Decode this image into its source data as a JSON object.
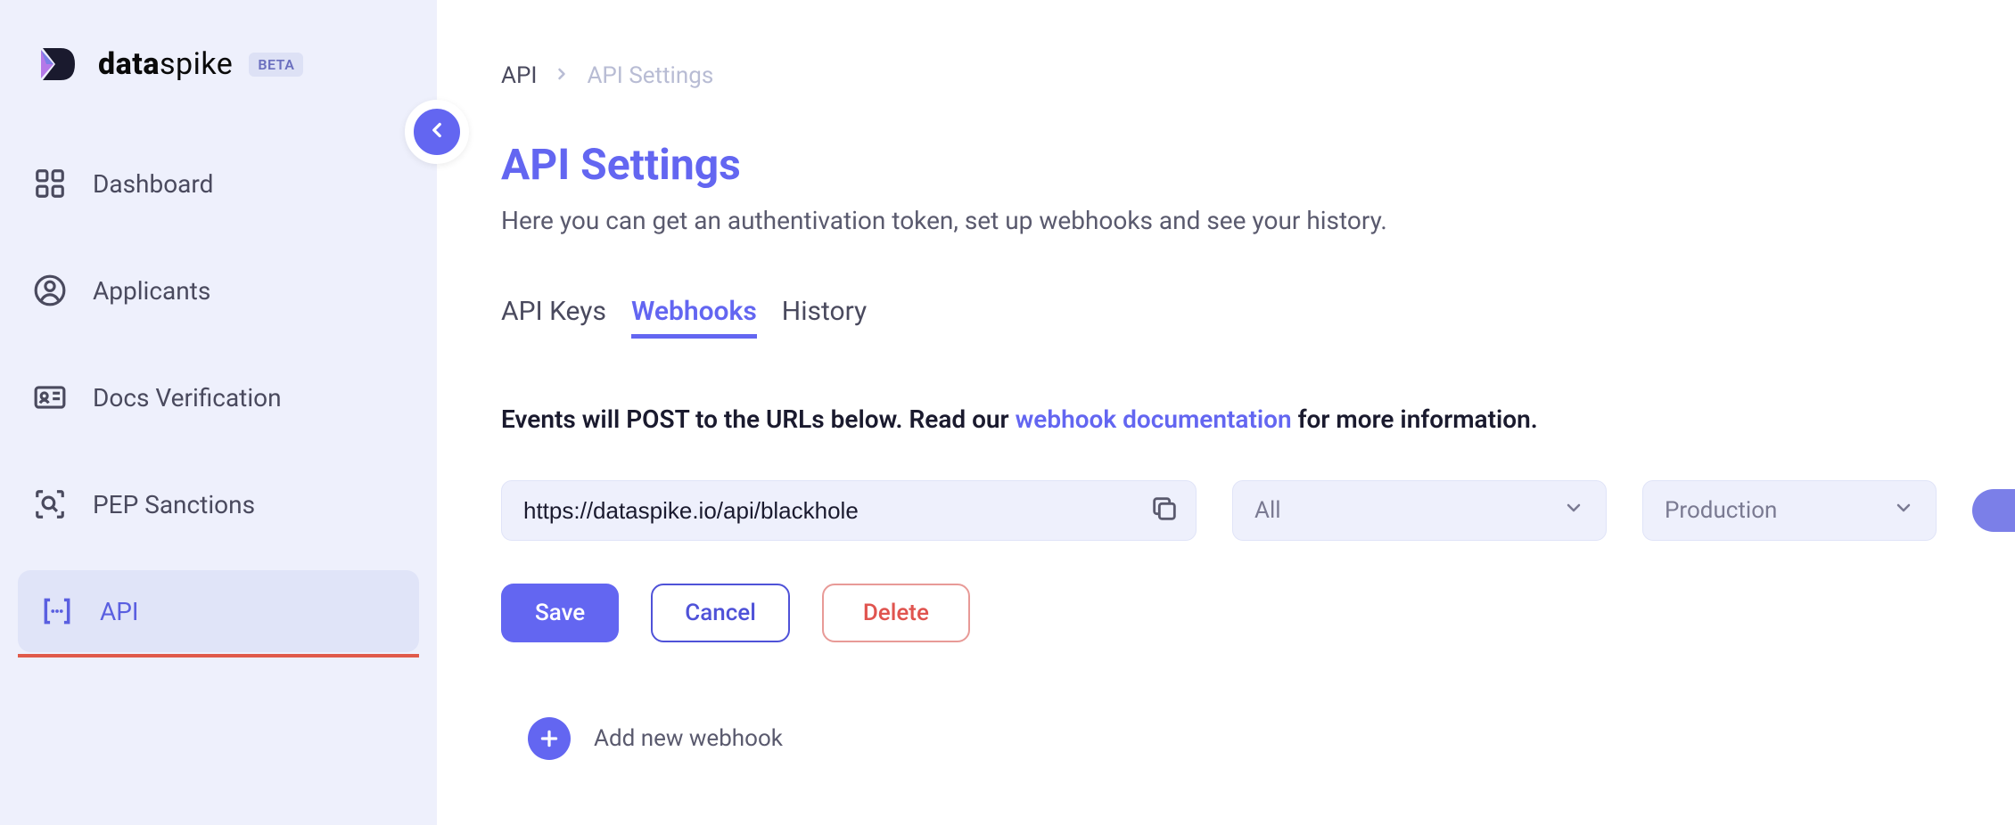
{
  "logo": {
    "brand_bold": "data",
    "brand_light": "spike",
    "badge": "BETA"
  },
  "sidebar": {
    "items": [
      {
        "label": "Dashboard"
      },
      {
        "label": "Applicants"
      },
      {
        "label": "Docs Verification"
      },
      {
        "label": "PEP Sanctions"
      },
      {
        "label": "API"
      }
    ]
  },
  "breadcrumb": {
    "root": "API",
    "current": "API Settings"
  },
  "page": {
    "title": "API Settings",
    "subtitle": "Here you can get an authentivation token, set up webhooks and see your history."
  },
  "tabs": {
    "api_keys": "API Keys",
    "webhooks": "Webhooks",
    "history": "History"
  },
  "info": {
    "prefix": "Events will POST to the URLs below. Read our ",
    "link": "webhook documentation",
    "suffix": " for more information."
  },
  "webhook": {
    "url": "https://dataspike.io/api/blackhole",
    "events_selected": "All",
    "env_selected": "Production"
  },
  "buttons": {
    "save": "Save",
    "cancel": "Cancel",
    "delete": "Delete",
    "add_new": "Add new webhook"
  }
}
